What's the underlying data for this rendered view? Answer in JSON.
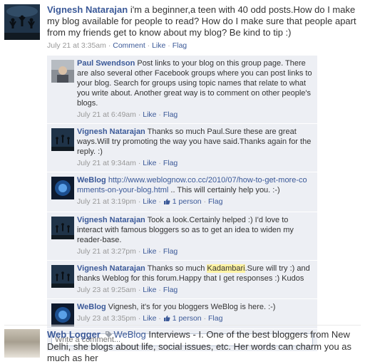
{
  "main_post": {
    "author": "Vignesh Natarajan",
    "text": " i'm a beginner,a teen with 40 odd posts.How do I make my blog available for people to read? How do I make sure that people apart from my friends get to know about my blog? Be kind to tip :)",
    "timestamp": "July 21 at 3:35am",
    "comment_label": "Comment",
    "like_label": "Like",
    "flag_label": "Flag"
  },
  "comments": [
    {
      "author": "Paul Swendson",
      "text": " Post links to your blog on this group page. There are also several other Facebook groups where you can post links to your blog. Search for groups using topic names that relate to what you write about. Another great way is to comment on other people's blogs.",
      "timestamp": "July 21 at 6:49am",
      "like_label": "Like",
      "flag_label": "Flag"
    },
    {
      "author": "Vignesh Natarajan",
      "text": " Thanks so much Paul.Sure these are great ways.Will try promoting the way you have said.Thanks again for the reply. :)",
      "timestamp": "July 21 at 9:34am",
      "like_label": "Like",
      "flag_label": "Flag"
    },
    {
      "author": "WeBlog",
      "link_text": "http://www.weblognow.co.cc/2010/07/how-to-get-more-comments-on-your-blog.html",
      "text_after": " .. This will certainly help you. :-)",
      "timestamp": "July 21 at 3:19pm",
      "like_label": "Like",
      "likes_count": "1 person",
      "flag_label": "Flag"
    },
    {
      "author": "Vignesh Natarajan",
      "text": " Took a look.Certainly helped :) I'd love to interact with famous bloggers so as to get an idea to widen my reader-base.",
      "timestamp": "July 21 at 3:27pm",
      "like_label": "Like",
      "flag_label": "Flag"
    },
    {
      "author": "Vignesh Natarajan",
      "text_before": " Thanks so much ",
      "highlight": "Kadambari",
      "text_after": ".Sure will try :) and thanks Weblog for this forum.Happy that I get responses :) Kudos",
      "timestamp": "July 23 at 9:25am",
      "like_label": "Like",
      "flag_label": "Flag"
    },
    {
      "author": "WeBlog",
      "text": " Vignesh, it's for you bloggers WeBlog is here. :-)",
      "timestamp": "July 23 at 3:35pm",
      "like_label": "Like",
      "likes_count": "1 person",
      "flag_label": "Flag"
    }
  ],
  "write_comment": {
    "placeholder": "Write a comment..."
  },
  "second_post": {
    "author": "Web Logger",
    "group": "WeBlog",
    "text": " Interviews - I. One of the best bloggers from New Delhi, she blogs about life, social issues, etc. Her words can charm you as much as her"
  },
  "colors": {
    "link": "#3b5998",
    "comment_bg": "#edeff4",
    "highlight": "#fff3a3"
  },
  "icons": {
    "like": "thumbs-up-icon",
    "tag": "tag-icon"
  }
}
